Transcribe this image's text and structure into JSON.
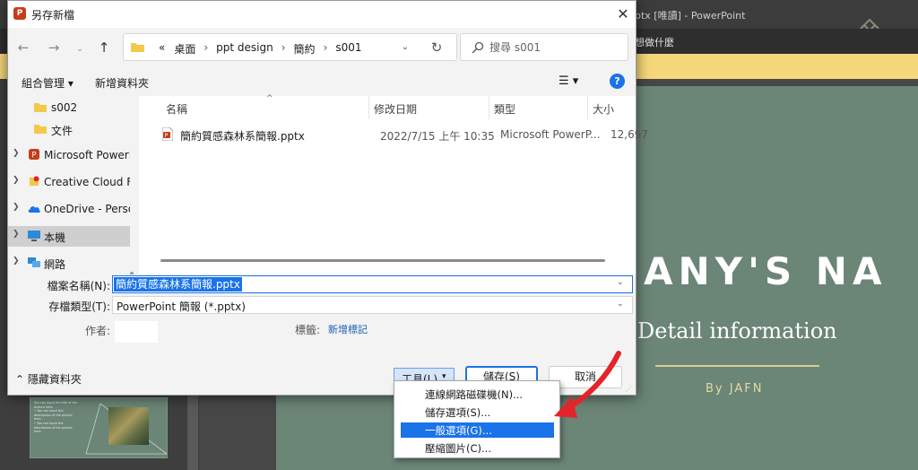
{
  "powerpoint": {
    "window_title": "ptx [唯讀]  -  PowerPoint",
    "ribbon_search_label": "想做什麼",
    "slide": {
      "title": "ANY'S NA",
      "subtitle": "Detail information",
      "byline": "By JAFN"
    },
    "thumbnail_text": "You can input the title of the\npicture here.\n• You can input the\n  description of the picture\n  here.\n• You can input the\n  description of the picture\n  here."
  },
  "dialog": {
    "title": "另存新檔",
    "app_icon": "P",
    "close_glyph": "✕",
    "nav": {
      "back": "←",
      "forward": "→",
      "recent": "⌄",
      "up": "↑"
    },
    "breadcrumb": {
      "overflow": "«",
      "items": [
        "桌面",
        "ppt design",
        "簡約",
        "s001"
      ],
      "separator": "›"
    },
    "address_dropdown_glyph": "⌄",
    "refresh_glyph": "↻",
    "search": {
      "placeholder": "搜尋 s001"
    },
    "toolbar": {
      "organize_label": "組合管理 ▾",
      "new_folder_label": "新增資料夾",
      "view_label": "☰  ▾",
      "help_label": "?"
    },
    "nav_pane": {
      "items": [
        {
          "label": "s002",
          "icon": "folder-icon"
        },
        {
          "label": "文件",
          "icon": "folder-icon"
        },
        {
          "label": "Microsoft PowerP",
          "icon": "powerpoint-icon"
        },
        {
          "label": "Creative Cloud Fi",
          "icon": "creative-cloud-icon"
        },
        {
          "label": "OneDrive - Perso",
          "icon": "onedrive-icon"
        },
        {
          "label": "本機",
          "icon": "computer-icon"
        },
        {
          "label": "網路",
          "icon": "network-icon"
        }
      ]
    },
    "file_list": {
      "columns": [
        "名稱",
        "修改日期",
        "類型",
        "大小"
      ],
      "sort_glyph": "^",
      "rows": [
        {
          "name": "簡約質感森林系簡報.pptx",
          "modified": "2022/7/15 上午 10:35",
          "type": "Microsoft PowerP...",
          "size": "12,697"
        }
      ]
    },
    "form": {
      "filename_label": "檔案名稱(N):",
      "filename_value": "簡約質感森林系簡報.pptx",
      "filetype_label": "存檔類型(T):",
      "filetype_value": "PowerPoint 簡報 (*.pptx)",
      "author_label": "作者:",
      "tags_label": "標籤:",
      "tags_link": "新增標記"
    },
    "footer": {
      "hide_folders": "⌃  隱藏資料夾",
      "tools_label": "工具(L)",
      "tools_caret": "▾",
      "save_label": "儲存(S)",
      "cancel_label": "取消"
    },
    "tools_menu": {
      "items": [
        "連線網路磁碟機(N)...",
        "儲存選項(S)...",
        "一般選項(G)...",
        "壓縮圖片(C)..."
      ],
      "active_index": 2
    }
  },
  "colors": {
    "accent": "#1a73e8",
    "slide_green": "#6b8577",
    "notice_yellow": "#f6d77a",
    "annotation_red": "#e3242b"
  }
}
